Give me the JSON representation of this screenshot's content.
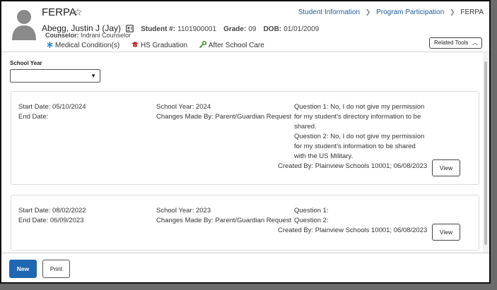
{
  "header": {
    "title": "FERPA",
    "student_name": "Abegg, Justin J (Jay)",
    "student_number_label": "Student #:",
    "student_number": "1101900001",
    "grade_label": "Grade:",
    "grade": "09",
    "dob_label": "DOB:",
    "dob": "01/01/2009",
    "counselor_label": "Counselor:",
    "counselor": "Indrani Counselor",
    "flags": [
      "Medical Condition(s)",
      "HS Graduation",
      "After School Care"
    ],
    "flag_colors": {
      "medical": "#2a8ed6",
      "graduation": "#c0282d",
      "after_school": "#4a8a2e"
    },
    "related_tools_label": "Related Tools"
  },
  "breadcrumb": {
    "items": [
      "Student Information",
      "Program Participation"
    ],
    "current": "FERPA",
    "link_color": "#1e5b9b"
  },
  "filter": {
    "school_year_label": "School Year",
    "school_year_value": ""
  },
  "records": [
    {
      "start_date": "Start Date: 05/10/2024",
      "end_date": "End Date:",
      "school_year": "School Year: 2024",
      "changes_by": "Changes Made By: Parent/Guardian Request",
      "q1_lines": [
        "Question 1: No, I do not give my permission",
        "for my student's directory information to be",
        "shared."
      ],
      "q2_lines": [
        "Question 2: No, I do not give my permission",
        "for my student's information to be shared",
        "with the US Military."
      ],
      "created_by": "Created By: Plainview Schools 10001; 06/08/2023",
      "view_label": "View"
    },
    {
      "start_date": "Start Date: 08/02/2022",
      "end_date": "End Date: 06/09/2023",
      "school_year": "School Year: 2023",
      "changes_by": "Changes Made By: Parent/Guardian Request",
      "q1_lines": [
        "Question 1:"
      ],
      "q2_lines": [
        "Question 2:"
      ],
      "created_by": "Created By: Plainview Schools 10001; 06/08/2023",
      "view_label": "View"
    }
  ],
  "footer": {
    "new_label": "New",
    "print_label": "Print",
    "primary_color": "#1f66b3"
  }
}
